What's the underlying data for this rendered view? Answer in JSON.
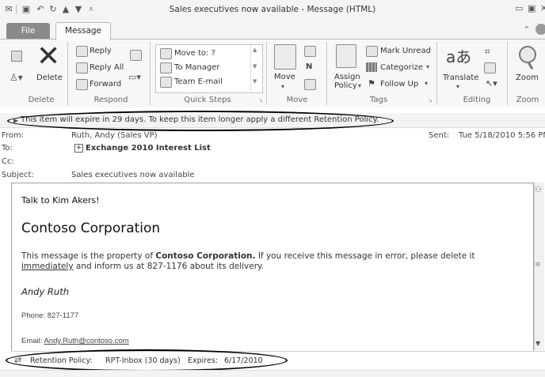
{
  "window": {
    "title": "Sales executives now available  -  Message (HTML)"
  },
  "tabs": {
    "file": "File",
    "message": "Message"
  },
  "ribbon": {
    "delete_group": {
      "delete": "Delete",
      "label": "Delete"
    },
    "respond_group": {
      "reply": "Reply",
      "reply_all": "Reply All",
      "forward": "Forward",
      "label": "Respond"
    },
    "quick_steps": {
      "items": [
        "Move to: ?",
        "To Manager",
        "Team E-mail"
      ],
      "label": "Quick Steps"
    },
    "move_group": {
      "move": "Move",
      "label": "Move"
    },
    "tags_group": {
      "assign_policy_1": "Assign",
      "assign_policy_2": "Policy",
      "mark_unread": "Mark Unread",
      "categorize": "Categorize",
      "follow_up": "Follow Up",
      "label": "Tags"
    },
    "editing_group": {
      "translate": "Translate",
      "label": "Editing"
    },
    "zoom_group": {
      "zoom": "Zoom",
      "label": "Zoom"
    }
  },
  "header": {
    "retention_notice": "This item will expire in 29 days. To keep this item longer apply a different Retention Policy.",
    "from_label": "From:",
    "from_value": "Ruth, Andy (Sales VP)",
    "to_label": "To:",
    "to_value": "Exchange 2010 Interest List",
    "cc_label": "Cc:",
    "subject_label": "Subject:",
    "subject_value": "Sales executives now available",
    "sent_label": "Sent:",
    "sent_value": "Tue 5/18/2010 5:56 PM"
  },
  "body": {
    "greeting": "Talk to Kim Akers!",
    "company": "Contoso Corporation",
    "disclaimer_prefix": "This message is the property of ",
    "disclaimer_company": "Contoso Corporation.",
    "disclaimer_suffix": " If you receive this message in error, please delete it",
    "disclaimer_link": "immediately",
    "disclaimer_line2": " and inform us at 827-1176 about its delivery.",
    "signature_name": "Andy Ruth",
    "phone": "Phone: 827-1177",
    "email_label": "Email: ",
    "email": "Andy.Ruth@contoso.com"
  },
  "footer": {
    "retention_label": "Retention Policy:",
    "retention_value": "RPT-Inbox (30 days)",
    "expires_label": "Expires:",
    "expires_value": "6/17/2010"
  }
}
